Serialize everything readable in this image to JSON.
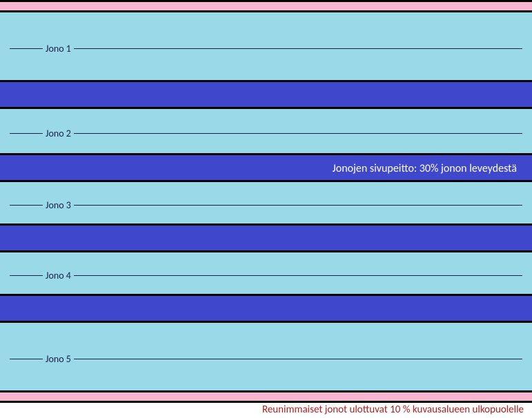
{
  "rows": {
    "r1": "Jono 1",
    "r2": "Jono 2",
    "r3": "Jono 3",
    "r4": "Jono 4",
    "r5": "Jono 5"
  },
  "overlap_label": "Jonojen sivupeitto: 30% jonon leveydestä",
  "footnote": "Reunimmaiset jonot ulottuvat 10 % kuvausalueen ulkopuolelle",
  "colors": {
    "edge": "#f7b5d0",
    "row": "#9ad9e8",
    "overlap": "#3f48cc",
    "border": "#000000",
    "label": "#18204a",
    "overlap_text": "#ffffff",
    "footnote_text": "#b02020"
  }
}
